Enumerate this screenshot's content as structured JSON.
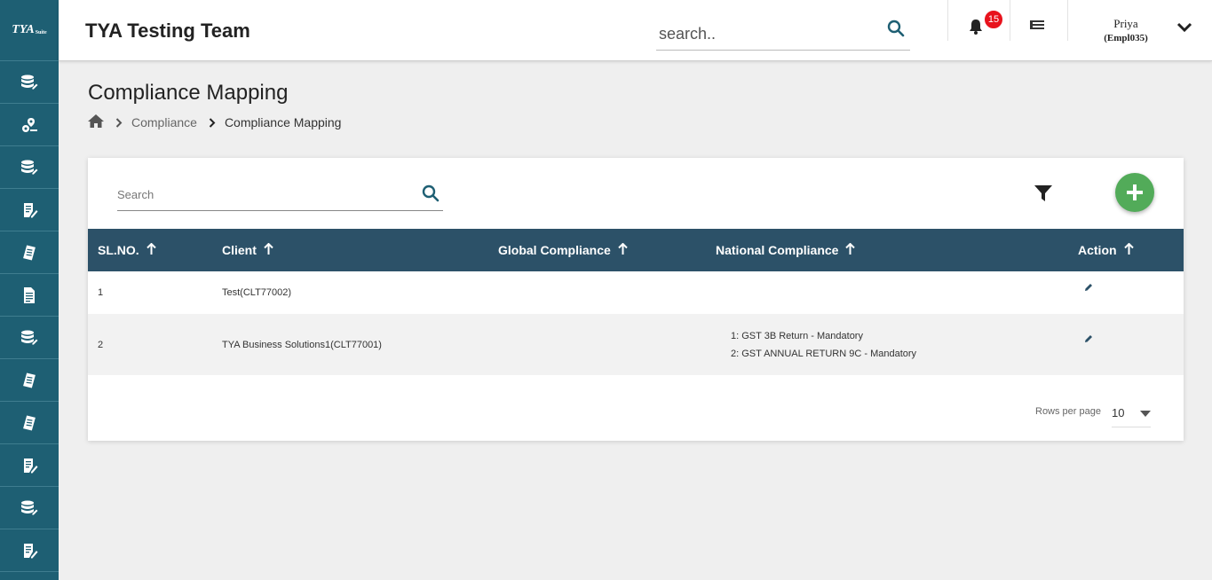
{
  "logo": {
    "text": "TYA",
    "suffix": "Suite"
  },
  "sidebar": {
    "items": [
      {
        "icon": "database-edit-icon"
      },
      {
        "icon": "location-settings-icon"
      },
      {
        "icon": "database-edit-icon"
      },
      {
        "icon": "document-edit-icon"
      },
      {
        "icon": "checklist-edit-icon"
      },
      {
        "icon": "document-icon"
      },
      {
        "icon": "database-edit-icon"
      },
      {
        "icon": "checklist-edit-icon"
      },
      {
        "icon": "checklist-edit-icon"
      },
      {
        "icon": "document-edit-icon"
      },
      {
        "icon": "database-edit-icon"
      },
      {
        "icon": "document-edit-icon"
      }
    ]
  },
  "header": {
    "title": "TYA Testing Team",
    "search_placeholder": "search..",
    "notification_count": "15",
    "user_name": "Priya",
    "user_id": "(Empl035)"
  },
  "page": {
    "title": "Compliance Mapping",
    "breadcrumb": [
      "Compliance",
      "Compliance Mapping"
    ]
  },
  "card": {
    "search_placeholder": "Search",
    "columns": [
      "SL.NO.",
      "Client",
      "Global Compliance",
      "National Compliance",
      "Action"
    ],
    "rows": [
      {
        "sl": "1",
        "client": "Test(CLT77002)",
        "global": "",
        "national": []
      },
      {
        "sl": "2",
        "client": "TYA Business Solutions1(CLT77001)",
        "global": "",
        "national": [
          "1: GST 3B Return - Mandatory",
          "2: GST ANNUAL RETURN 9C - Mandatory"
        ]
      }
    ],
    "rows_per_page_label": "Rows per page",
    "rows_per_page": "10"
  },
  "colors": {
    "sidebar": "#1e5f73",
    "table_header": "#2c5168",
    "fab": "#52ab59",
    "badge": "#e8121c"
  }
}
